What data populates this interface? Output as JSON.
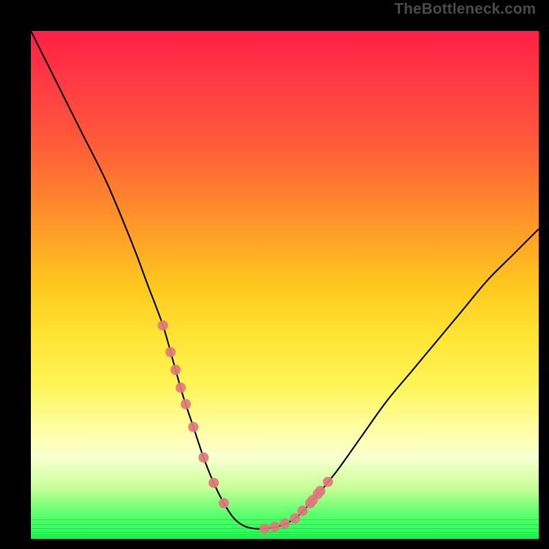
{
  "watermark": "TheBottleneck.com",
  "chart_data": {
    "type": "line",
    "title": "",
    "xlabel": "",
    "ylabel": "",
    "xlim": [
      0,
      100
    ],
    "ylim": [
      0,
      100
    ],
    "series": [
      {
        "name": "bottleneck-curve",
        "x": [
          0,
          5,
          10,
          15,
          20,
          23,
          26,
          28,
          30,
          32,
          34,
          36,
          38,
          40,
          42,
          44,
          46,
          49,
          52,
          55,
          60,
          65,
          70,
          75,
          80,
          85,
          90,
          95,
          100
        ],
        "values": [
          100,
          90,
          80,
          70,
          58,
          50,
          42,
          35,
          28,
          22,
          16,
          11,
          7,
          4,
          2.5,
          2,
          2,
          2.5,
          4,
          7,
          13,
          20,
          27,
          33,
          39,
          45,
          51,
          56,
          61
        ]
      }
    ],
    "markers": {
      "name": "highlight-dots",
      "color": "#e07a7a",
      "left_cluster_x": [
        26,
        27.5,
        28.5,
        29.5,
        30.5,
        32,
        34,
        36,
        38
      ],
      "right_cluster_x": [
        46,
        48,
        50,
        52,
        53.5,
        55,
        57,
        58.5,
        55.5,
        56.5
      ]
    },
    "background": {
      "gradient_top": "#ff1f45",
      "gradient_bottom": "#1cff54"
    }
  }
}
